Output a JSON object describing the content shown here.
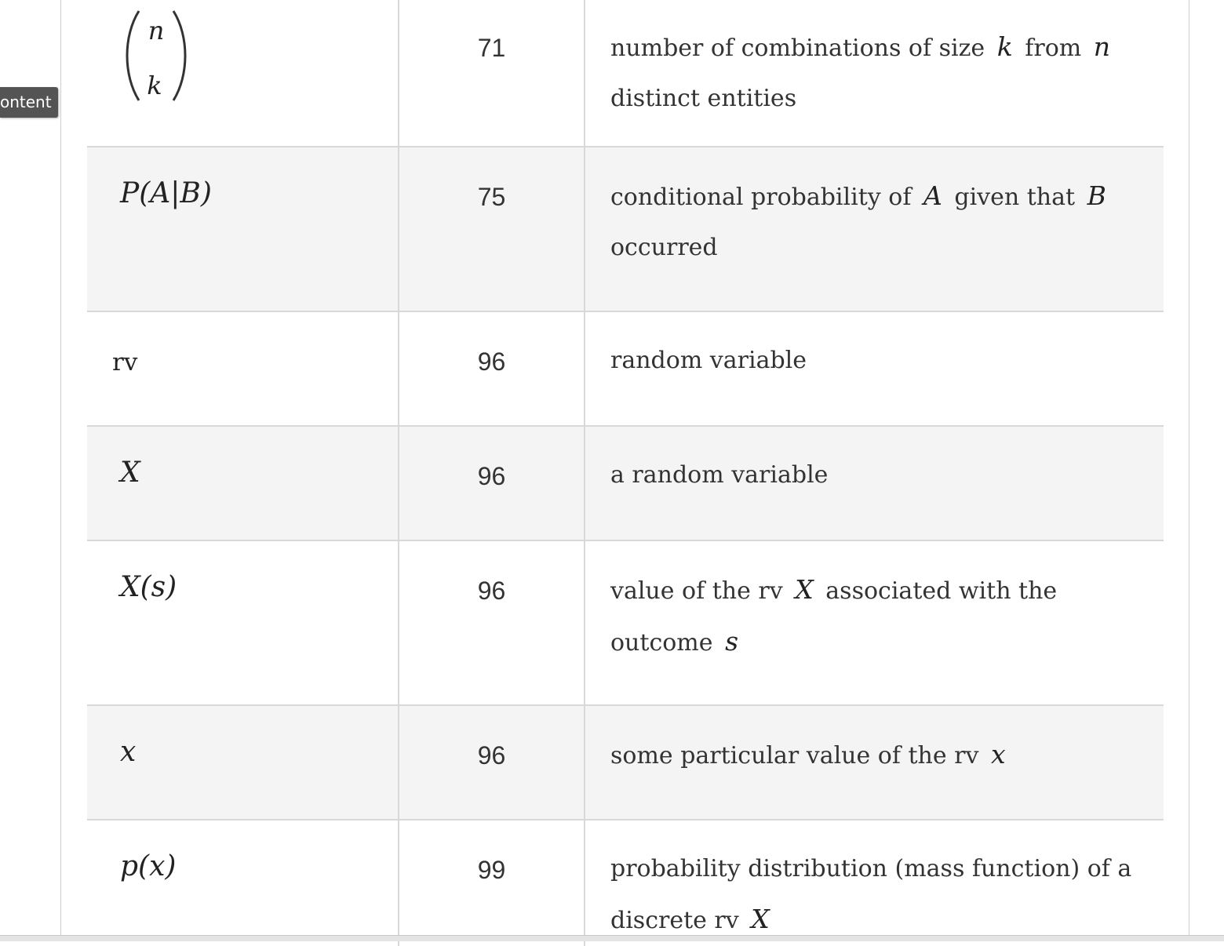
{
  "tooltip": {
    "label": "ontent"
  },
  "rows": [
    {
      "symbol_top": "n",
      "symbol_bottom": "k",
      "page": "71",
      "m": [
        "number of combinations of size",
        "k",
        "from",
        "n",
        "distinct entities"
      ]
    },
    {
      "symbol": "P(A|B)",
      "page": "75",
      "m": [
        "conditional probability of",
        "A",
        "given that",
        "B",
        "occurred"
      ]
    },
    {
      "symbol": "rv",
      "page": "96",
      "m": [
        "random variable"
      ]
    },
    {
      "symbol": "X",
      "page": "96",
      "m": [
        "a random variable"
      ]
    },
    {
      "symbol": "X(s)",
      "page": "96",
      "m": [
        "value of the rv",
        "X",
        "associated with the",
        "outcome",
        "s"
      ]
    },
    {
      "symbol": "x",
      "page": "96",
      "m": [
        "some particular value of the rv",
        "x"
      ]
    },
    {
      "symbol": "p(x)",
      "page": "99",
      "m": [
        "probability distribution (mass function) of a",
        "discrete rv",
        "X"
      ]
    }
  ]
}
